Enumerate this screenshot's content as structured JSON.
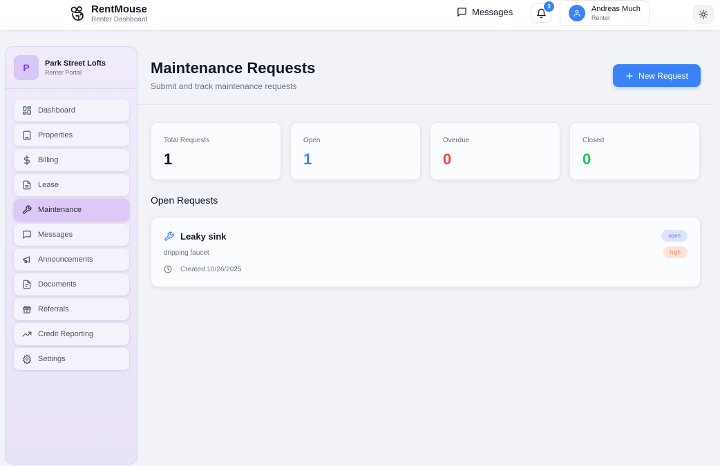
{
  "brand": {
    "name": "RentMouse",
    "subtitle": "Renter Dashboard"
  },
  "topbar": {
    "messages_label": "Messages",
    "notification_count": "3",
    "user": {
      "name": "Andreas Much",
      "role": "Renter"
    }
  },
  "sidebar": {
    "org_initial": "P",
    "org_name": "Park Street Lofts",
    "org_subtitle": "Renter Portal",
    "items": [
      {
        "label": "Dashboard",
        "icon": "dashboard-icon"
      },
      {
        "label": "Properties",
        "icon": "building-icon"
      },
      {
        "label": "Billing",
        "icon": "dollar-icon"
      },
      {
        "label": "Lease",
        "icon": "document-icon"
      },
      {
        "label": "Maintenance",
        "icon": "wrench-icon",
        "active": true
      },
      {
        "label": "Messages",
        "icon": "chat-icon"
      },
      {
        "label": "Announcements",
        "icon": "megaphone-icon"
      },
      {
        "label": "Documents",
        "icon": "file-icon"
      },
      {
        "label": "Referrals",
        "icon": "gift-icon"
      },
      {
        "label": "Credit Reporting",
        "icon": "trending-up-icon"
      },
      {
        "label": "Settings",
        "icon": "gear-icon"
      }
    ]
  },
  "header": {
    "title": "Maintenance Requests",
    "subtitle": "Submit and track maintenance requests",
    "new_button": "New Request"
  },
  "stats": [
    {
      "label": "Total Requests",
      "value": "1",
      "color": "#111827"
    },
    {
      "label": "Open",
      "value": "1",
      "color": "#3b82f6"
    },
    {
      "label": "Overdue",
      "value": "0",
      "color": "#ef4444"
    },
    {
      "label": "Closed",
      "value": "0",
      "color": "#22c55e"
    }
  ],
  "open_requests": {
    "title": "Open Requests",
    "items": [
      {
        "title": "Leaky sink",
        "description": "dripping faucet",
        "created": "Created 10/26/2025",
        "status": "open",
        "priority": "high"
      }
    ]
  },
  "colors": {
    "accent": "#3b82f6",
    "active_nav": "#dcc9f6",
    "sidebar_bg": "#f0ebfb"
  }
}
